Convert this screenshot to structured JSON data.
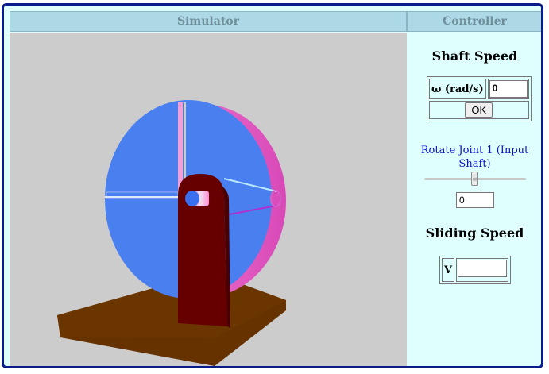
{
  "header": {
    "simulator_title": "Simulator",
    "controller_title": "Controller"
  },
  "controller": {
    "shaft_speed": {
      "title": "Shaft Speed",
      "omega_label": "ω (rad/s)",
      "omega_value": "0",
      "ok_label": "OK"
    },
    "rotate_joint": {
      "label": "Rotate Joint 1 (Input Shaft)",
      "slider_level": 0.5,
      "value": "0"
    },
    "sliding_speed": {
      "title": "Sliding Speed",
      "v_label": "V",
      "v_value": ""
    }
  },
  "colors": {
    "frame_border": "#0a1c8c",
    "header_bg": "#add8e6",
    "panel_bg": "#dfffff",
    "viewport_bg": "#cccccc",
    "disk": "#4a7ff0",
    "disk_rim": "#e86ac8",
    "bracket": "#660000",
    "base": "#663300"
  }
}
